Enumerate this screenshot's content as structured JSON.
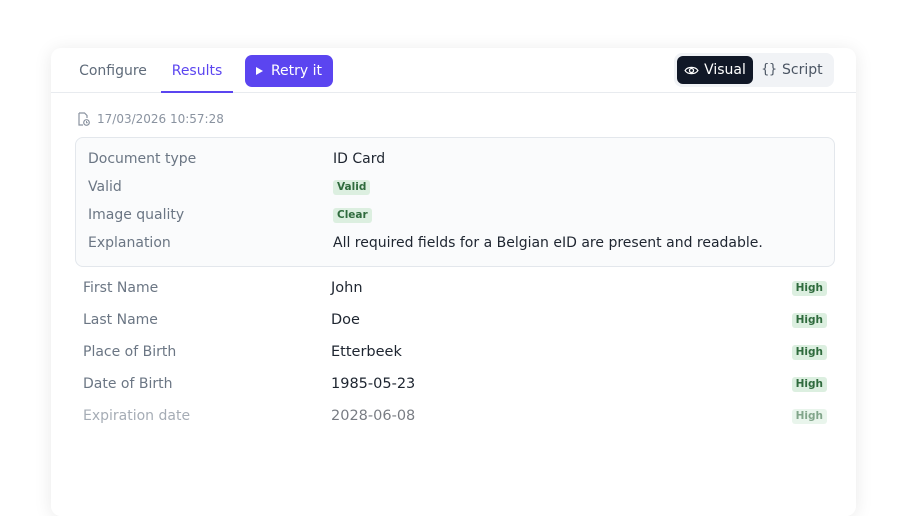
{
  "tabs": {
    "configure": "Configure",
    "results": "Results"
  },
  "retry_label": "Retry it",
  "view_toggle": {
    "visual": "Visual",
    "script": "Script"
  },
  "timestamp": "17/03/2026 10:57:28",
  "summary": {
    "document_type_label": "Document type",
    "document_type_value": "ID Card",
    "valid_label": "Valid",
    "valid_badge": "Valid",
    "image_quality_label": "Image quality",
    "image_quality_badge": "Clear",
    "explanation_label": "Explanation",
    "explanation_value": "All required fields for a Belgian eID are present and readable."
  },
  "fields": [
    {
      "label": "First Name",
      "value": "John",
      "confidence": "High"
    },
    {
      "label": "Last Name",
      "value": "Doe",
      "confidence": "High"
    },
    {
      "label": "Place of Birth",
      "value": "Etterbeek",
      "confidence": "High"
    },
    {
      "label": "Date of Birth",
      "value": "1985-05-23",
      "confidence": "High"
    },
    {
      "label": "Expiration date",
      "value": "2028-06-08",
      "confidence": "High"
    }
  ],
  "colors": {
    "accent": "#5b45f0",
    "badge_bg": "#dcefe0",
    "badge_text": "#2f6b3d",
    "dark_toggle": "#111827"
  },
  "icons": {
    "retry": "play-icon",
    "visual": "eye-icon",
    "script": "braces-icon",
    "timestamp": "document-clock-icon"
  }
}
